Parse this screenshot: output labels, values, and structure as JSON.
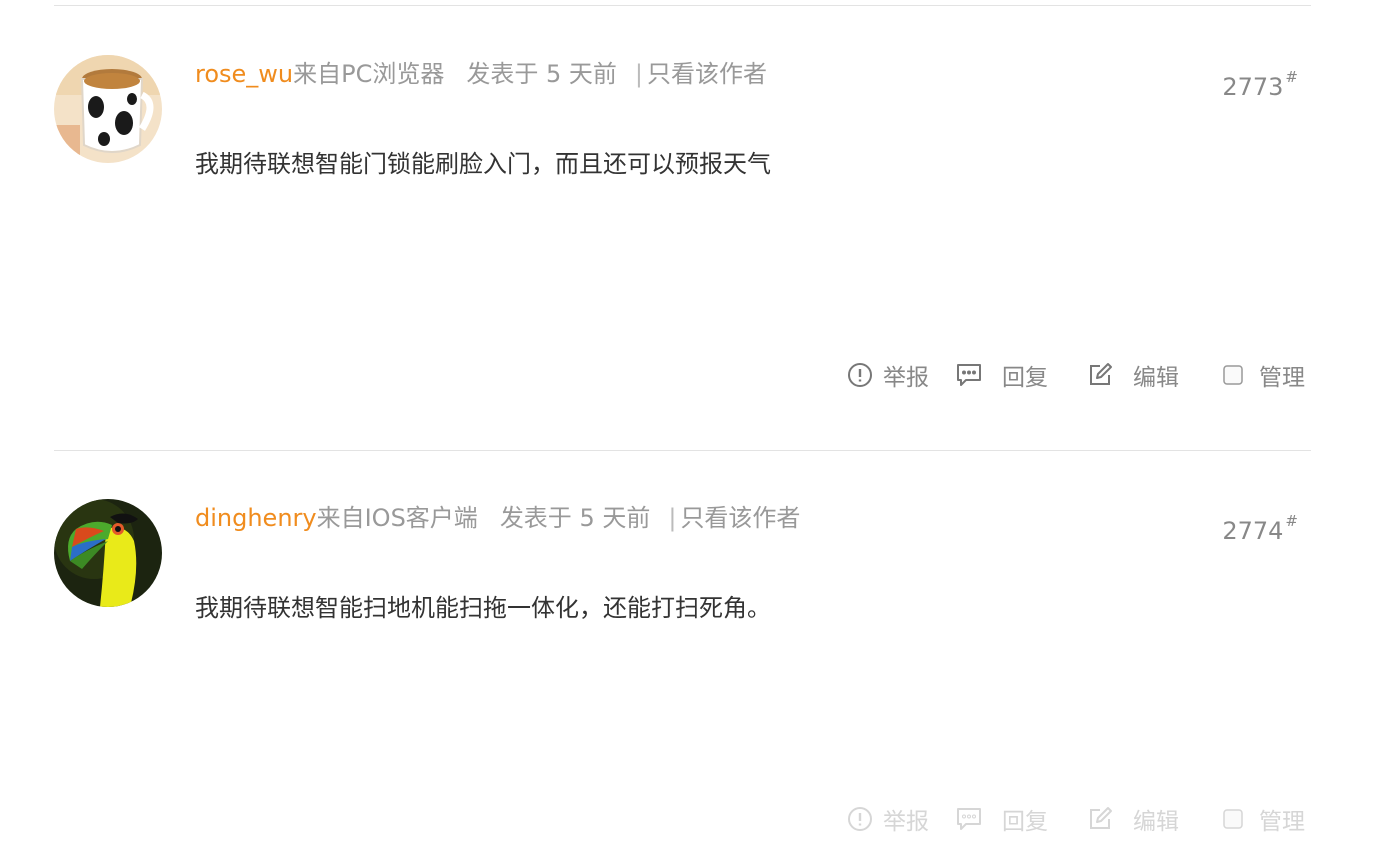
{
  "posts": [
    {
      "author": "rose_wu",
      "source": "来自PC浏览器",
      "time": "发表于 5 天前",
      "separator": "|",
      "only_author": "只看该作者",
      "floor": "2773",
      "floor_mark": "#",
      "content": "我期待联想智能门锁能刷脸入门，而且还可以预报天气",
      "actions": {
        "report": "举报",
        "reply": "回复",
        "edit": "编辑",
        "manage": "管理"
      }
    },
    {
      "author": "dinghenry",
      "source": "来自IOS客户端",
      "time": "发表于 5 天前",
      "separator": "|",
      "only_author": "只看该作者",
      "floor": "2774",
      "floor_mark": "#",
      "content": "我期待联想智能扫地机能扫拖一体化，还能打扫死角。",
      "actions": {
        "report": "举报",
        "reply": "回复",
        "edit": "编辑",
        "manage": "管理"
      }
    }
  ],
  "colors": {
    "author": "#f08c1e",
    "meta": "#999999",
    "content": "#333333",
    "action": "#888888",
    "action_faded": "#d6d6d6",
    "divider": "#e3e3e3"
  }
}
